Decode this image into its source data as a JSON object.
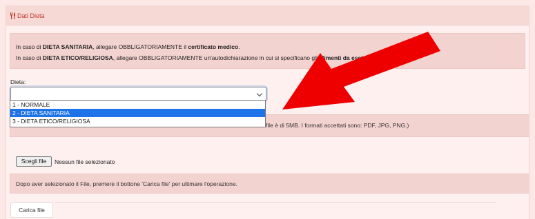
{
  "panel": {
    "title": "Dati Dieta",
    "icon": "fork-knife-icon"
  },
  "alert": {
    "line1": [
      {
        "t": "In caso di ",
        "b": false
      },
      {
        "t": "DIETA SANITARIA",
        "b": true
      },
      {
        "t": ", allegare OBBLIGATORIAMENTE il ",
        "b": false
      },
      {
        "t": "certificato medico",
        "b": true
      },
      {
        "t": ".",
        "b": false
      }
    ],
    "line2": [
      {
        "t": "In caso di ",
        "b": false
      },
      {
        "t": "DIETA ETICO/RELIGIOSA",
        "b": true
      },
      {
        "t": ", allegare OBBLIGATORIAMENTE un'autodichiarazione in cui si specificano gli ",
        "b": false
      },
      {
        "t": "alimenti da escludere",
        "b": true
      },
      {
        "t": ".",
        "b": false
      }
    ]
  },
  "dieta": {
    "label": "Dieta:",
    "selected_value": "",
    "options": [
      "1 - NORMALE",
      "2 - DIETA SANITARIA",
      "3 - DIETA ETICO/RELIGIOSA"
    ],
    "highlighted_index": 1
  },
  "upload_info": "file è di 5MB. I formati accettati sono: PDF, JPG, PNG.)",
  "file": {
    "button_label": "Scegli file",
    "status": "Nessun file selezionato"
  },
  "note": "Dopo aver selezionato il File, premere il bottone 'Carica file' per ultimare l'operazione.",
  "upload_button": "Carica file",
  "colors": {
    "accent_red": "#c0392b",
    "arrow_red": "#ee0000",
    "option_highlight": "#1e73e8"
  }
}
